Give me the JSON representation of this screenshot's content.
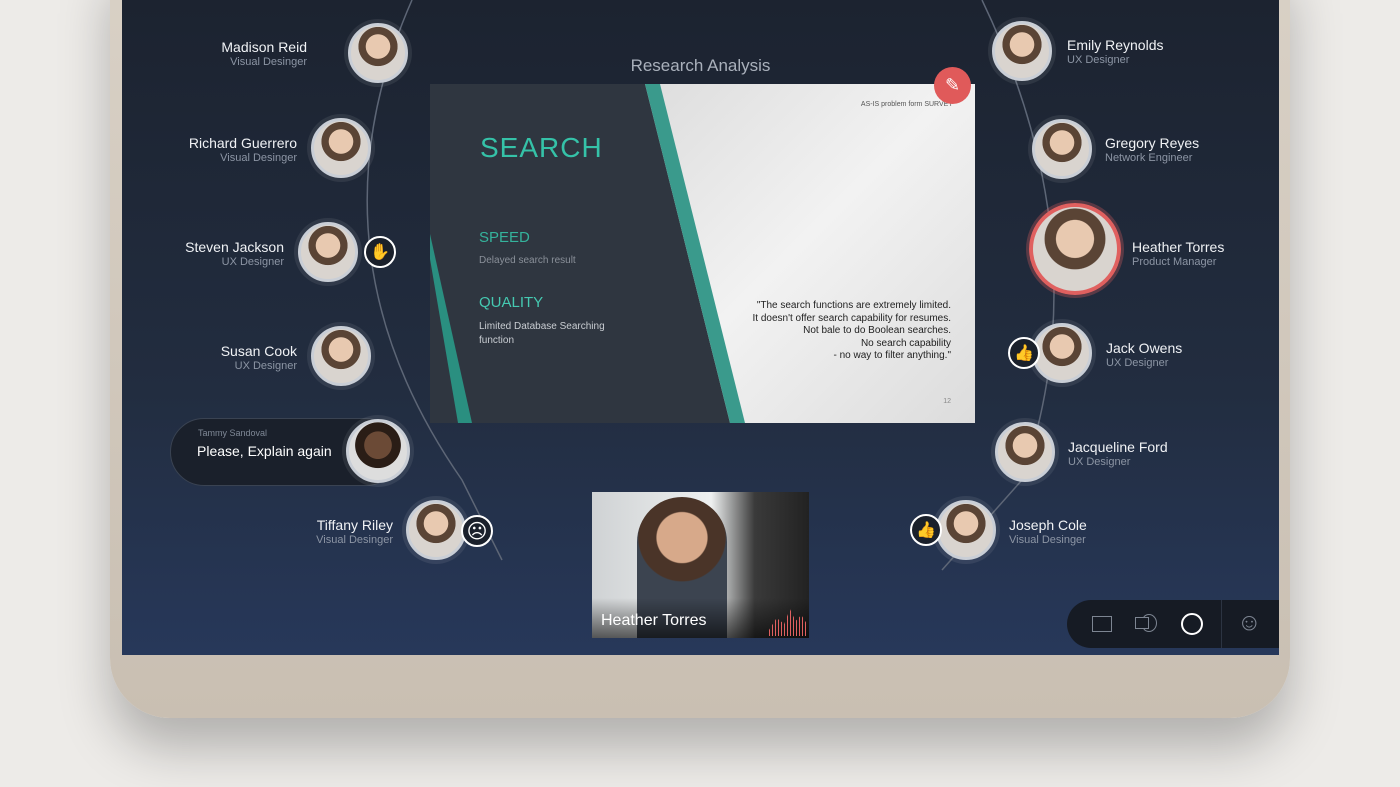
{
  "presentation": {
    "title": "Research Analysis",
    "slide": {
      "header": "AS-IS problem form SURVEY",
      "title": "SEARCH",
      "speed_label": "SPEED",
      "speed_text": "Delayed search result",
      "quality_label": "QUALITY",
      "quality_text": "Limited Database Searching function",
      "quote": [
        "\"The search functions are extremely limited.",
        "It doesn't offer search capability for resumes.",
        "Not bale to do Boolean searches.",
        "No search capability",
        "- no way to filter anything.\""
      ],
      "page": "12"
    },
    "edit_icon": "pencil-icon"
  },
  "participants_left": [
    {
      "name": "Madison Reid",
      "role": "Visual Desinger"
    },
    {
      "name": "Richard Guerrero",
      "role": "Visual Desinger"
    },
    {
      "name": "Steven Jackson",
      "role": "UX Designer",
      "reaction": "raised-hand-icon"
    },
    {
      "name": "Susan Cook",
      "role": "UX Designer"
    },
    {
      "name": "Tiffany Riley",
      "role": "Visual Desinger",
      "reaction": "sad-face-icon"
    }
  ],
  "participants_right": [
    {
      "name": "Emily Reynolds",
      "role": "UX Designer"
    },
    {
      "name": "Gregory Reyes",
      "role": "Network Engineer"
    },
    {
      "name": "Heather Torres",
      "role": "Product Manager",
      "speaking": true
    },
    {
      "name": "Jack Owens",
      "role": "UX Designer",
      "reaction": "thumbs-up-icon"
    },
    {
      "name": "Jacqueline Ford",
      "role": "UX Designer"
    },
    {
      "name": "Joseph Cole",
      "role": "Visual Desinger",
      "reaction": "thumbs-up-icon"
    }
  ],
  "comment": {
    "author": "Tammy Sandoval",
    "text": "Please, Explain again"
  },
  "video": {
    "name": "Heather Torres"
  },
  "toolbar": [
    "square-icon",
    "screen-share-icon",
    "circle-icon",
    "smiley-icon"
  ],
  "colors": {
    "accent": "#2fb5a0",
    "speaking": "#e0605f",
    "edit": "#e05a5a"
  }
}
